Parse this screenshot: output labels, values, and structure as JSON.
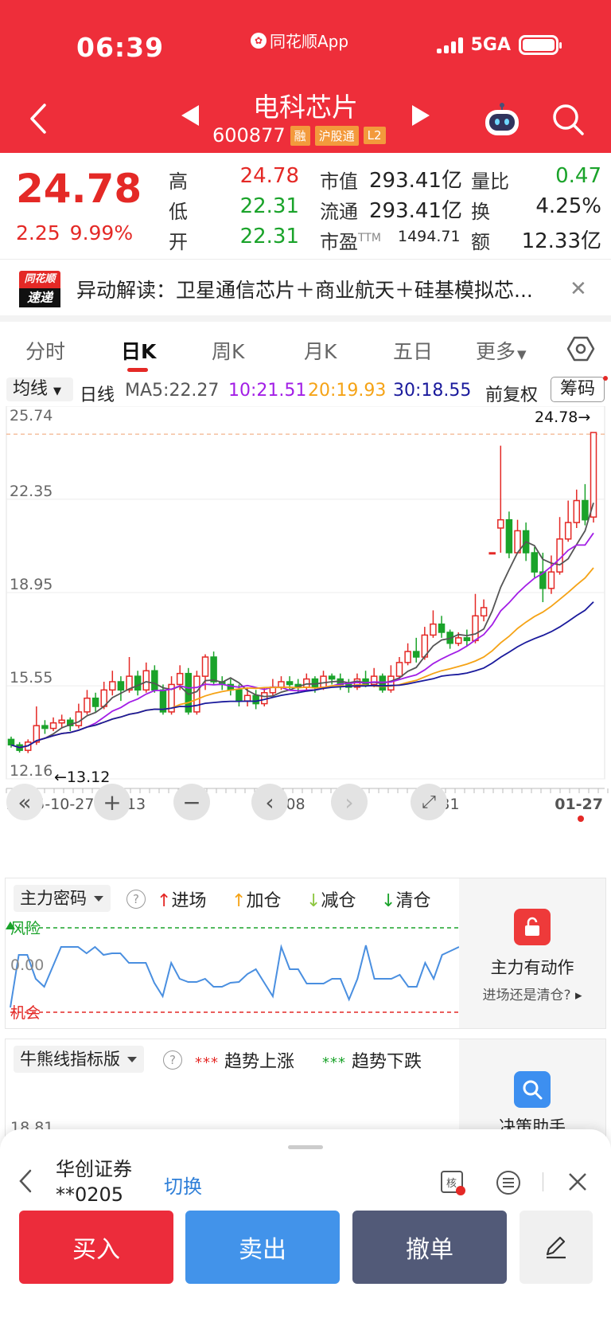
{
  "status": {
    "time": "06:39",
    "app": "同花顺App",
    "network": "5GA"
  },
  "nav": {
    "title": "电科芯片",
    "code": "600877",
    "tags": [
      "融",
      "沪股通",
      "L2"
    ]
  },
  "quote": {
    "price": "24.78",
    "change": "2.25",
    "change_pct": "9.99%",
    "rows": [
      {
        "k1": "高",
        "v1": "24.78",
        "c1": "red",
        "k2": "市值",
        "v2": "293.41亿",
        "k3": "量比",
        "v3": "0.47",
        "c3": "green"
      },
      {
        "k1": "低",
        "v1": "22.31",
        "c1": "green",
        "k2": "流通",
        "v2": "293.41亿",
        "k3": "换",
        "v3": "4.25%",
        "c3": "dark"
      },
      {
        "k1": "开",
        "v1": "22.31",
        "c1": "green",
        "k2": "市盈",
        "k2sup": "TTM",
        "v2": "1494.71",
        "k3": "额",
        "v3": "12.33亿",
        "c3": "dark"
      }
    ]
  },
  "news": {
    "logo_top": "同花顺",
    "logo_bottom": "速递",
    "text": "异动解读：卫星通信芯片＋商业航天＋硅基模拟芯..."
  },
  "tabs": [
    "分时",
    "日K",
    "周K",
    "月K",
    "五日",
    "更多"
  ],
  "ma": {
    "select": "均线",
    "period": "日线",
    "ma5": "MA5:22.27",
    "ma10": "10:21.51",
    "ma20": "20:19.93",
    "ma30": "30:18.55",
    "adjust": "前复权",
    "chip": "筹码"
  },
  "colors": {
    "up": "#e42926",
    "down": "#1aa32a",
    "ma5": "#555555",
    "ma10": "#a21ee6",
    "ma20": "#f5a316",
    "ma30": "#1a1a9c",
    "brand": "#ee2e3a"
  },
  "chart_data": {
    "type": "candlestick",
    "y_axis_labels": [
      "25.74",
      "22.35",
      "18.95",
      "15.55",
      "12.16"
    ],
    "x_axis_labels": [
      "2025-10-27",
      "1-13",
      "12-08",
      "12-31",
      "01-27"
    ],
    "ylim": [
      12.16,
      25.74
    ],
    "high_marker": "24.78→",
    "low_marker": "←13.12",
    "candles": [
      [
        13.6,
        13.4,
        13.7,
        13.3
      ],
      [
        13.4,
        13.2,
        13.5,
        13.12
      ],
      [
        13.2,
        13.5,
        13.6,
        13.1
      ],
      [
        13.5,
        14.1,
        14.8,
        13.4
      ],
      [
        14.1,
        14.0,
        14.3,
        13.8
      ],
      [
        14.0,
        14.2,
        14.4,
        13.9
      ],
      [
        14.2,
        14.3,
        14.5,
        14.0
      ],
      [
        14.3,
        14.1,
        14.4,
        13.9
      ],
      [
        14.1,
        14.6,
        14.9,
        14.0
      ],
      [
        14.6,
        15.1,
        15.4,
        14.5
      ],
      [
        15.1,
        14.8,
        15.3,
        14.6
      ],
      [
        14.8,
        15.4,
        15.7,
        14.7
      ],
      [
        15.4,
        15.7,
        16.1,
        15.2
      ],
      [
        15.7,
        15.4,
        15.9,
        15.0
      ],
      [
        15.4,
        15.9,
        16.6,
        15.3
      ],
      [
        15.9,
        15.4,
        16.1,
        15.2
      ],
      [
        15.4,
        16.1,
        16.4,
        15.3
      ],
      [
        16.1,
        15.4,
        16.3,
        15.3
      ],
      [
        15.4,
        14.6,
        15.6,
        14.5
      ],
      [
        14.6,
        15.6,
        15.9,
        14.5
      ],
      [
        15.6,
        16.0,
        16.3,
        15.4
      ],
      [
        16.0,
        14.6,
        16.2,
        14.5
      ],
      [
        14.6,
        15.9,
        16.1,
        14.5
      ],
      [
        15.9,
        16.6,
        16.7,
        15.4
      ],
      [
        16.6,
        15.7,
        16.8,
        15.6
      ],
      [
        15.7,
        15.6,
        15.9,
        15.4
      ],
      [
        15.6,
        15.4,
        15.8,
        15.2
      ],
      [
        15.4,
        15.0,
        15.6,
        14.8
      ],
      [
        15.0,
        15.2,
        15.5,
        14.8
      ],
      [
        15.2,
        14.9,
        15.4,
        14.7
      ],
      [
        14.9,
        15.3,
        15.5,
        14.8
      ],
      [
        15.3,
        15.5,
        15.8,
        15.2
      ],
      [
        15.5,
        15.7,
        15.9,
        15.4
      ],
      [
        15.7,
        15.6,
        15.9,
        15.4
      ],
      [
        15.6,
        15.5,
        15.8,
        15.3
      ],
      [
        15.5,
        15.8,
        16.0,
        15.4
      ],
      [
        15.8,
        15.5,
        15.9,
        15.3
      ],
      [
        15.5,
        15.9,
        16.1,
        15.4
      ],
      [
        15.9,
        15.8,
        16.0,
        15.6
      ],
      [
        15.8,
        15.6,
        16.0,
        15.4
      ],
      [
        15.6,
        15.5,
        15.8,
        15.3
      ],
      [
        15.5,
        15.8,
        16.0,
        15.4
      ],
      [
        15.8,
        15.6,
        16.1,
        15.5
      ],
      [
        15.6,
        15.9,
        16.2,
        15.5
      ],
      [
        15.9,
        15.4,
        16.0,
        15.3
      ],
      [
        15.4,
        15.9,
        16.3,
        15.3
      ],
      [
        15.9,
        16.4,
        16.6,
        15.8
      ],
      [
        16.4,
        16.8,
        17.1,
        16.3
      ],
      [
        16.8,
        16.6,
        17.3,
        16.4
      ],
      [
        16.6,
        17.4,
        17.7,
        16.5
      ],
      [
        17.4,
        17.8,
        18.3,
        17.3
      ],
      [
        17.8,
        17.5,
        18.1,
        17.3
      ],
      [
        17.5,
        17.1,
        17.6,
        16.9
      ],
      [
        17.1,
        17.3,
        17.5,
        17.0
      ],
      [
        17.3,
        17.2,
        17.6,
        17.0
      ],
      [
        17.2,
        18.1,
        18.9,
        17.1
      ],
      [
        18.1,
        18.4,
        18.7,
        17.9
      ],
      [
        20.4,
        20.4,
        20.4,
        20.4
      ],
      [
        21.3,
        21.6,
        24.3,
        20.4
      ],
      [
        21.6,
        20.4,
        21.9,
        20.2
      ],
      [
        20.4,
        21.2,
        21.6,
        20.4
      ],
      [
        21.2,
        20.4,
        21.5,
        20.1
      ],
      [
        20.4,
        19.7,
        20.6,
        19.5
      ],
      [
        19.7,
        19.1,
        20.4,
        18.6
      ],
      [
        19.1,
        19.7,
        20.3,
        18.9
      ],
      [
        19.7,
        20.9,
        21.7,
        19.6
      ],
      [
        20.9,
        21.5,
        22.3,
        20.8
      ],
      [
        21.5,
        22.3,
        22.7,
        21.3
      ],
      [
        22.3,
        21.6,
        22.9,
        21.4
      ],
      [
        21.7,
        24.78,
        24.78,
        21.5
      ]
    ]
  },
  "panel1": {
    "select": "主力密码",
    "legend": [
      "进场",
      "加仓",
      "减仓",
      "清仓"
    ],
    "label_risk": "风险",
    "label_zero": "0.00",
    "label_chance": "机会",
    "side_title": "主力有动作",
    "side_sub": "进场还是清仓?"
  },
  "panel2": {
    "select": "牛熊线指标版",
    "legend": [
      "趋势上涨",
      "趋势下跌"
    ],
    "axis_value": "18.81",
    "side_title": "决策助手"
  },
  "trade": {
    "broker": "华创证券",
    "account": "**0205",
    "switch": "切换",
    "buy": "买入",
    "sell": "卖出",
    "cancel": "撤单"
  }
}
